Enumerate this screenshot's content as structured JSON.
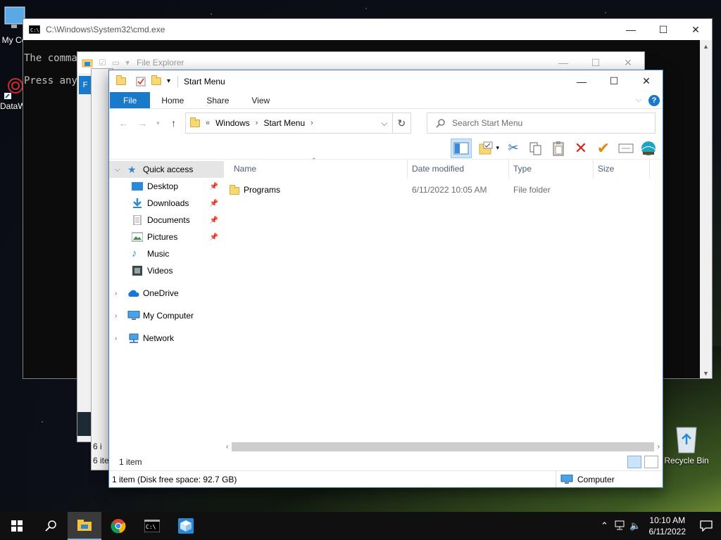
{
  "desktop": {
    "icons": [
      {
        "label": "My Co",
        "icon": "monitor-icon"
      },
      {
        "label": "DataW",
        "icon": "datawarehouse-icon"
      },
      {
        "label": "Recycle Bin",
        "icon": "recycle-bin-icon"
      }
    ]
  },
  "cmd_window": {
    "title": "C:\\Windows\\System32\\cmd.exe",
    "lines": [
      "The comman",
      "Press any "
    ]
  },
  "back_explorer": {
    "title": "File Explorer",
    "status_a": "6 i",
    "status_b": "6 ite"
  },
  "explorer": {
    "title": "Start Menu",
    "tabs": [
      "File",
      "Home",
      "Share",
      "View"
    ],
    "breadcrumb": [
      "Windows",
      "Start Menu"
    ],
    "search_placeholder": "Search Start Menu",
    "nav": {
      "quick_access": "Quick access",
      "quick_items": [
        "Desktop",
        "Downloads",
        "Documents",
        "Pictures",
        "Music",
        "Videos"
      ],
      "onedrive": "OneDrive",
      "my_computer": "My Computer",
      "network": "Network"
    },
    "columns": [
      "Name",
      "Date modified",
      "Type",
      "Size"
    ],
    "rows": [
      {
        "name": "Programs",
        "date": "6/11/2022 10:05 AM",
        "type": "File folder",
        "size": ""
      }
    ],
    "item_count": "1 item",
    "status_free": "1 item (Disk free space: 92.7 GB)",
    "status_zone": "Computer"
  },
  "taskbar": {
    "time": "10:10 AM",
    "date": "6/11/2022"
  }
}
